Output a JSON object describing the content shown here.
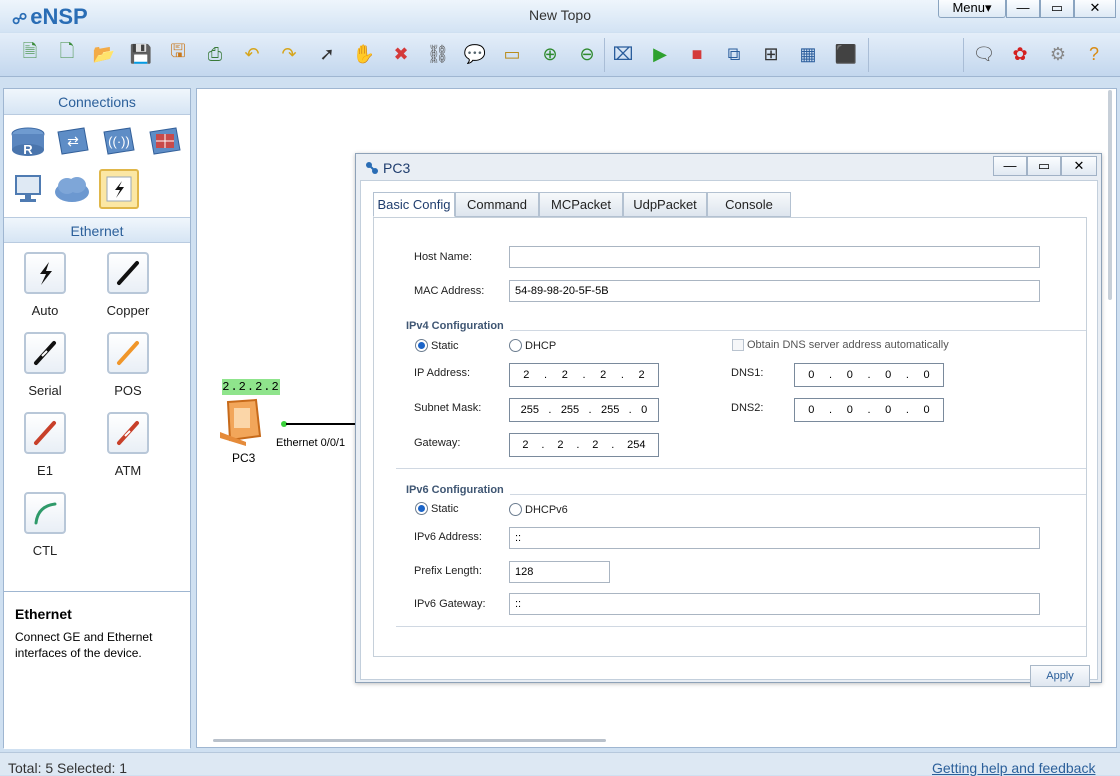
{
  "app": {
    "name": "eNSP",
    "window_title": "New Topo",
    "menu_label": "Menu▾",
    "min": "—",
    "max": "▭",
    "close": "✕"
  },
  "toolbar": {
    "items": [
      {
        "name": "new-topo-icon",
        "glyph": "🗎",
        "color": "#3b8c3b"
      },
      {
        "name": "new-blank-icon",
        "glyph": "🗋",
        "color": "#3b8c3b"
      },
      {
        "name": "open-icon",
        "glyph": "📂",
        "color": "#d59b1d"
      },
      {
        "name": "save-icon",
        "glyph": "💾",
        "color": "#2a5d9c"
      },
      {
        "name": "save-as-icon",
        "glyph": "🖫",
        "color": "#c9781b"
      },
      {
        "name": "print-icon",
        "glyph": "⎙",
        "color": "#3a7a3a"
      },
      {
        "name": "undo-icon",
        "glyph": "↶",
        "color": "#d6a51b"
      },
      {
        "name": "redo-icon",
        "glyph": "↷",
        "color": "#d6a51b"
      },
      {
        "name": "select-icon",
        "glyph": "➚",
        "color": "#333"
      },
      {
        "name": "hand-icon",
        "glyph": "✋",
        "color": "#d79f3a"
      },
      {
        "name": "delete-icon",
        "glyph": "✖",
        "color": "#d43a3a"
      },
      {
        "name": "delete-link-icon",
        "glyph": "⛓",
        "color": "#555"
      },
      {
        "name": "text-icon",
        "glyph": "💬",
        "color": "#4a9a4a"
      },
      {
        "name": "rect-icon",
        "glyph": "▭",
        "color": "#b98c1b"
      },
      {
        "name": "zoom-in-icon",
        "glyph": "⊕",
        "color": "#2f8a2f"
      },
      {
        "name": "zoom-out-icon",
        "glyph": "⊖",
        "color": "#2f8a2f"
      },
      {
        "name": "fit-icon",
        "glyph": "⌧",
        "color": "#2a5d9c"
      },
      {
        "name": "start-icon",
        "glyph": "▶",
        "color": "#2ea12e"
      },
      {
        "name": "stop-icon",
        "glyph": "■",
        "color": "#d43a3a"
      },
      {
        "name": "capture-icon",
        "glyph": "⧉",
        "color": "#2a5d9c"
      },
      {
        "name": "topology-icon",
        "glyph": "⊞",
        "color": "#333"
      },
      {
        "name": "table-icon",
        "glyph": "▦",
        "color": "#2a5d9c"
      },
      {
        "name": "screen-icon",
        "glyph": "⬛",
        "color": "#333"
      }
    ],
    "right": [
      {
        "name": "chat-icon",
        "glyph": "🗨",
        "color": "#555"
      },
      {
        "name": "huawei-icon",
        "glyph": "✿",
        "color": "#d42020"
      },
      {
        "name": "settings-icon",
        "glyph": "⚙",
        "color": "#888"
      },
      {
        "name": "help-icon",
        "glyph": "?",
        "color": "#d98b12"
      }
    ]
  },
  "left": {
    "connections_title": "Connections",
    "ethernet_title": "Ethernet",
    "cables": [
      {
        "label": "Auto"
      },
      {
        "label": "Copper"
      },
      {
        "label": "Serial"
      },
      {
        "label": "POS"
      },
      {
        "label": "E1"
      },
      {
        "label": "ATM"
      },
      {
        "label": "CTL"
      }
    ],
    "info_title": "Ethernet",
    "info_text": "Connect GE and Ethernet interfaces of the device."
  },
  "topo": {
    "pc_ip": "2.2.2.2",
    "pc_name": "PC3",
    "port": "Ethernet 0/0/1"
  },
  "status": {
    "text": "Total: 5  Selected: 1",
    "help": "Getting help and feedback"
  },
  "dialog": {
    "title": "PC3",
    "tabs": [
      "Basic Config",
      "Command",
      "MCPacket",
      "UdpPacket",
      "Console"
    ],
    "host_name_label": "Host Name:",
    "host_name": "",
    "mac_label": "MAC Address:",
    "mac": "54-89-98-20-5F-5B",
    "ipv4_title": "IPv4 Configuration",
    "static": "Static",
    "dhcp": "DHCP",
    "dns_auto": "Obtain DNS server address automatically",
    "ip_label": "IP Address:",
    "ip": [
      "2",
      "2",
      "2",
      "2"
    ],
    "mask_label": "Subnet Mask:",
    "mask": [
      "255",
      "255",
      "255",
      "0"
    ],
    "gw_label": "Gateway:",
    "gw": [
      "2",
      "2",
      "2",
      "254"
    ],
    "dns1_label": "DNS1:",
    "dns1": [
      "0",
      "0",
      "0",
      "0"
    ],
    "dns2_label": "DNS2:",
    "dns2": [
      "0",
      "0",
      "0",
      "0"
    ],
    "ipv6_title": "IPv6 Configuration",
    "static6": "Static",
    "dhcpv6": "DHCPv6",
    "ipv6_label": "IPv6 Address:",
    "ipv6": "::",
    "prefix_label": "Prefix Length:",
    "prefix": "128",
    "ipv6_gw_label": "IPv6 Gateway:",
    "ipv6_gw": "::",
    "apply": "Apply"
  }
}
